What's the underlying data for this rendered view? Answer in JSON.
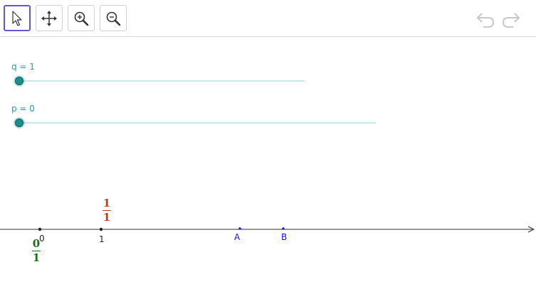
{
  "toolbar": {
    "tools": [
      {
        "name": "move-tool",
        "icon": "arrow-cursor-icon",
        "active": true
      },
      {
        "name": "move-graphics-view-tool",
        "icon": "four-way-arrows-icon",
        "active": false
      },
      {
        "name": "zoom-in-tool",
        "icon": "zoom-in-icon",
        "active": false
      },
      {
        "name": "zoom-out-tool",
        "icon": "zoom-out-icon",
        "active": false
      }
    ],
    "undo_icon": "undo-icon",
    "redo_icon": "redo-icon"
  },
  "sliders": {
    "q": {
      "label": "q = 1",
      "value": 1,
      "position_fraction": 0
    },
    "p": {
      "label": "p = 0",
      "value": 0,
      "position_fraction": 0
    }
  },
  "number_line": {
    "ticks": [
      {
        "label": "0"
      },
      {
        "label": "1"
      }
    ],
    "fraction_zero": {
      "numerator": "0",
      "denominator": "1",
      "color": "#1a6b1a"
    },
    "fraction_one": {
      "numerator": "1",
      "denominator": "1",
      "color": "#c83c0a"
    },
    "points": [
      {
        "label": "A"
      },
      {
        "label": "B"
      }
    ]
  },
  "colors": {
    "accent": "#6557d2",
    "slider": "#1aa3a3",
    "point": "#1515c8"
  }
}
